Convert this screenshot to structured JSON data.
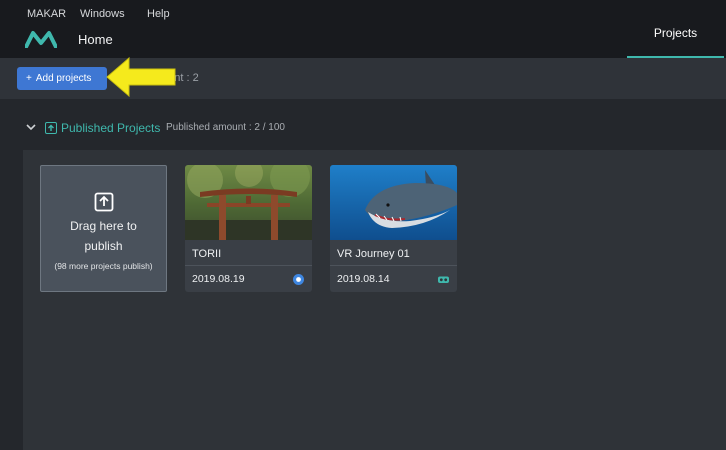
{
  "menubar": {
    "items": [
      "MAKAR",
      "Windows",
      "Help"
    ],
    "home_label": "Home",
    "projects_tab": "Projects"
  },
  "toolbar": {
    "add_label": "Add projects",
    "amount_partial": "ount : 2"
  },
  "published": {
    "title": "Published Projects",
    "amount": "Published amount : 2 / 100"
  },
  "drop_card": {
    "line1": "Drag here to",
    "line2": "publish",
    "note": "(98 more projects publish)"
  },
  "projects": [
    {
      "name": "TORII",
      "date": "2019.08.19",
      "badge": "ar-icon"
    },
    {
      "name": "VR Journey 01",
      "date": "2019.08.14",
      "badge": "vr-headset-icon"
    }
  ],
  "colors": {
    "accent": "#3fb8ad",
    "button": "#3e77d3",
    "annotation_arrow": "#f5ea1c",
    "background": "#24272c"
  }
}
